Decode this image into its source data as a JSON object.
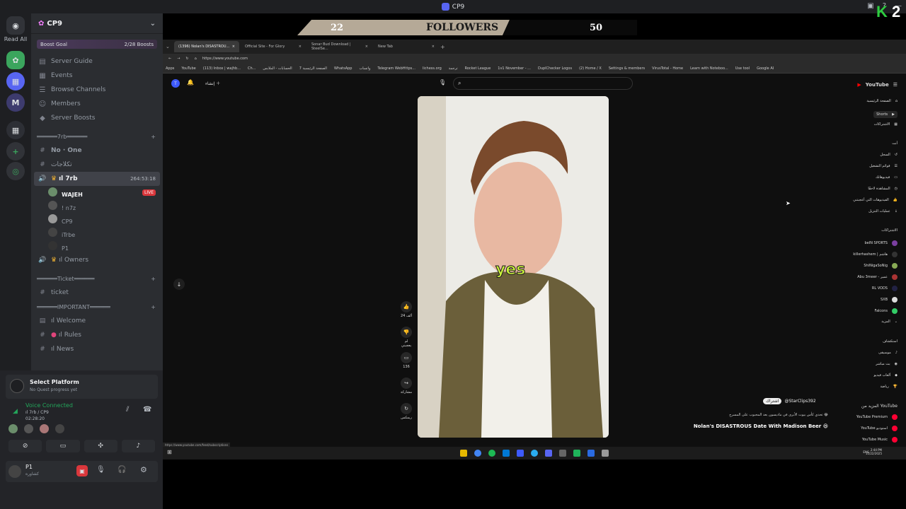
{
  "window": {
    "title": "CP9"
  },
  "rail": {
    "read_all": "Read All"
  },
  "server": {
    "name": "CP9",
    "boost_label": "Boost Goal",
    "boost_count": "2/28 Boosts"
  },
  "nav": [
    {
      "label": "Server Guide",
      "icon": "guide-icon"
    },
    {
      "label": "Events",
      "icon": "calendar-icon"
    },
    {
      "label": "Browse Channels",
      "icon": "browse-icon"
    },
    {
      "label": "Members",
      "icon": "members-icon"
    },
    {
      "label": "Server Boosts",
      "icon": "boost-icon"
    }
  ],
  "categories": {
    "c1": "══════7rb══════",
    "c2": "══════Ticket══════",
    "c3": "══════IMPORTANT══════"
  },
  "channels": {
    "no_one": "No · One",
    "arabic": "تكلاجات",
    "voice_7rb": "ıl 7rb",
    "voice_time": "264:53:18",
    "owners": "ıl Owners",
    "ticket": "ticket",
    "welcome": "ıl Welcome",
    "rules": "ıl Rules",
    "news": "ıl News"
  },
  "voice_users": [
    {
      "name": "WAJEH",
      "live": "LIVE"
    },
    {
      "name": "! n7z"
    },
    {
      "name": "CP9"
    },
    {
      "name": "iTrbe"
    },
    {
      "name": "P1"
    }
  ],
  "quest": {
    "title": "Select Platform",
    "subtitle": "No Quest progress yet"
  },
  "voice": {
    "status": "Voice Connected",
    "channel": "ıl 7rb / CP9",
    "time": "02:28:20"
  },
  "user": {
    "name": "P1",
    "status": "كشاوره"
  },
  "overlay": {
    "left_count": "22",
    "label": "FOLLOWERS",
    "right_count": "50",
    "brand": "2"
  },
  "browser": {
    "tabs": [
      "(1396) Nolan's DISASTROU...",
      "Official Site - For Glory",
      "Sonar Bud Download | SteelSe...",
      "New Tab"
    ],
    "url": "https://www.youtube.com",
    "bookmarks": [
      "Apps",
      "YouTube",
      "(113) Inbox | wajhb...",
      "Ch...",
      "الحسابات - الملابس",
      "الصفحة الرئيسية 7",
      "WhatsApp",
      "واتساب",
      "Telegram WebHttps...",
      "lichess.org",
      "ترجمة",
      "Rocket League",
      "1v1 November - ...",
      "DuplChecker Logos",
      "(2) Home / X",
      "Settings & members",
      "VirusTotal - Home",
      "Learn with Noteboo...",
      "Use tool",
      "Google AI"
    ],
    "status_url": "https://www.youtube.com/feed/subscriptions"
  },
  "youtube": {
    "logo": "YouTube",
    "caption": "yes",
    "channel": "@StarClips392",
    "subscribe": "اشتراك",
    "desc": "تحدي كأس بيوت الأبرى في ماديسون بعد المحبوب على المسرح 😂",
    "title": "Nolan's DISASTROUS Date With Madison Beer 😆",
    "actions": [
      {
        "icon": "like-icon",
        "label": "24 ألف"
      },
      {
        "icon": "dislike-icon",
        "label": "لم يعجبني"
      },
      {
        "icon": "comment-icon",
        "label": "136"
      },
      {
        "icon": "share-icon",
        "label": "مشاركة"
      },
      {
        "icon": "remix-icon",
        "label": "ريمكس"
      }
    ],
    "sidebar": {
      "top": [
        "الصفحة الرئيسية",
        "Shorts",
        "الاشتراكات"
      ],
      "you_header": "أنت",
      "you": [
        "السجل",
        "قوائم التشغيل",
        "فيديوهاتك",
        "المشاهدة لاحقًا",
        "الفيديوهات التي أعجبتني",
        "عمليات التنزيل"
      ],
      "subs_header": "الاشتراكات",
      "subs": [
        "beIN SPORTS",
        "killerhashem | هاشم",
        "ShiNigaSoNig",
        "Abu 3meer - عمير",
        "RL VODS",
        "SXB",
        "Falcons",
        "المزيد"
      ],
      "explore_header": "استكشاف",
      "explore": [
        "موسيقى",
        "بث مباشر",
        "ألعاب فيديو",
        "رياضة"
      ],
      "more_header": "المزيد من YouTube",
      "more": [
        "YouTube Premium",
        "YouTube استوديو",
        "YouTube Music"
      ]
    }
  },
  "taskbar": {
    "time": "2:44 PM",
    "date": "11/22/2025",
    "lang": "ENG"
  }
}
